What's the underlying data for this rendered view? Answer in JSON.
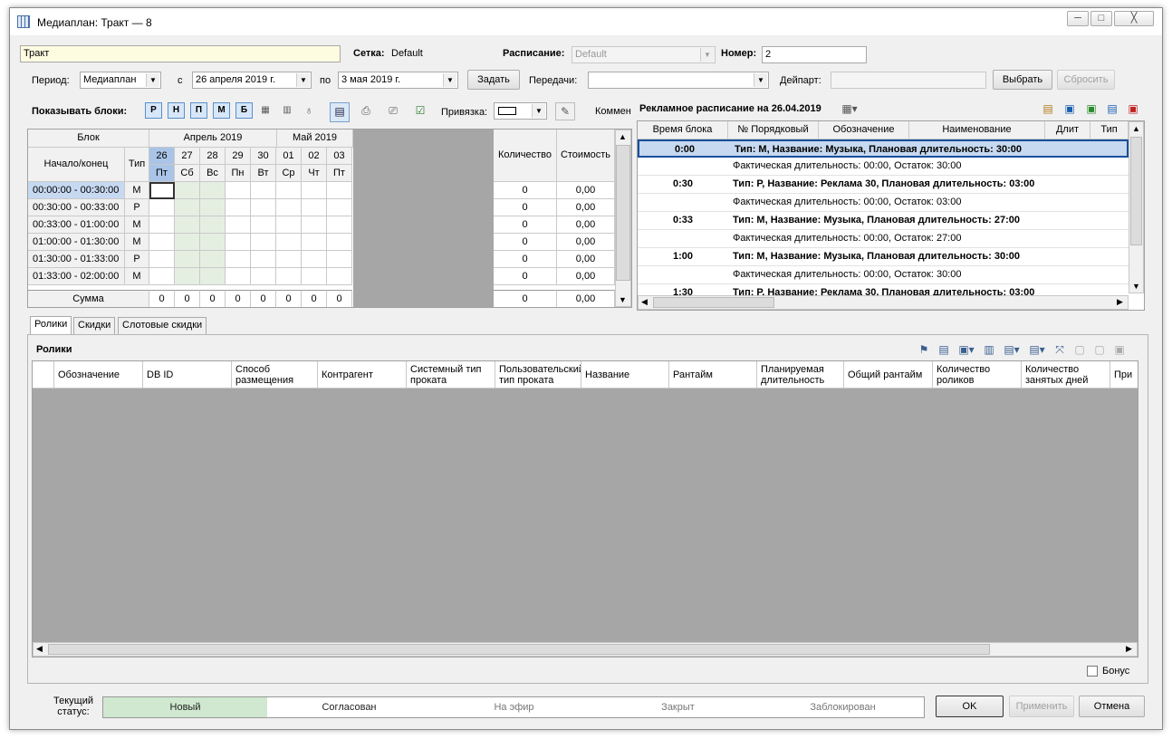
{
  "window": {
    "title": "Медиаплан: Тракт — 8",
    "minimize": "─",
    "maximize": "□",
    "close": "╳"
  },
  "form": {
    "name_value": "Тракт",
    "grid_label": "Сетка:",
    "grid_value": "Default",
    "schedule_label": "Расписание:",
    "schedule_value": "Default",
    "number_label": "Номер:",
    "number_value": "2",
    "period_label": "Период:",
    "period_value": "Медиаплан",
    "from_label": "с",
    "from_value": "26  апреля  2019 г.",
    "to_label": "по",
    "to_value": "3    мая     2019 г.",
    "set_button": "Задать",
    "programs_label": "Передачи:",
    "programs_value": "",
    "daypart_label": "Дейпарт:",
    "daypart_value": "",
    "choose_button": "Выбрать",
    "reset_button": "Сбросить"
  },
  "toolbar": {
    "show_blocks_label": "Показывать блоки:",
    "blocks": [
      "Р",
      "Н",
      "П",
      "М",
      "Б"
    ],
    "binding_label": "Привязка:",
    "comment_label": "Коммен"
  },
  "grid": {
    "block_header": "Блок",
    "start_end_header": "Начало/конец",
    "type_header": "Тип",
    "month1": "Апрель 2019",
    "month2": "Май 2019",
    "days": [
      "26",
      "27",
      "28",
      "29",
      "30",
      "01",
      "02",
      "03"
    ],
    "weekdays": [
      "Пт",
      "Сб",
      "Вс",
      "Пн",
      "Вт",
      "Ср",
      "Чт",
      "Пт"
    ],
    "qty_header": "Количество",
    "cost_header": "Стоимость",
    "rows": [
      {
        "time": "00:00:00 - 00:30:00",
        "type": "М",
        "qty": "0",
        "cost": "0,00"
      },
      {
        "time": "00:30:00 - 00:33:00",
        "type": "Р",
        "qty": "0",
        "cost": "0,00"
      },
      {
        "time": "00:33:00 - 01:00:00",
        "type": "М",
        "qty": "0",
        "cost": "0,00"
      },
      {
        "time": "01:00:00 - 01:30:00",
        "type": "М",
        "qty": "0",
        "cost": "0,00"
      },
      {
        "time": "01:30:00 - 01:33:00",
        "type": "Р",
        "qty": "0",
        "cost": "0,00"
      },
      {
        "time": "01:33:00 - 02:00:00",
        "type": "М",
        "qty": "0",
        "cost": "0,00"
      }
    ],
    "sum_label": "Сумма",
    "sums": [
      "0",
      "0",
      "0",
      "0",
      "0",
      "0",
      "0",
      "0"
    ],
    "sum_qty": "0",
    "sum_cost": "0,00"
  },
  "schedule": {
    "title": "Рекламное расписание на 26.04.2019",
    "columns": [
      "Время блока",
      "№ Порядковый",
      "Обозначение",
      "Наименование",
      "Длит",
      "Тип"
    ],
    "blocks": [
      {
        "time": "0:00",
        "desc": "Тип: М, Название: Музыка, Плановая длительность: 30:00",
        "fact": "Фактическая длительность: 00:00, Остаток: 30:00"
      },
      {
        "time": "0:30",
        "desc": "Тип: Р, Название: Реклама 30, Плановая длительность: 03:00",
        "fact": "Фактическая длительность: 00:00, Остаток: 03:00"
      },
      {
        "time": "0:33",
        "desc": "Тип: М, Название: Музыка, Плановая длительность: 27:00",
        "fact": "Фактическая длительность: 00:00, Остаток: 27:00"
      },
      {
        "time": "1:00",
        "desc": "Тип: М, Название: Музыка, Плановая длительность: 30:00",
        "fact": "Фактическая длительность: 00:00, Остаток: 30:00"
      },
      {
        "time": "1:30",
        "desc": "Тип: Р, Название: Реклама 30, Плановая длительность: 03:00",
        "fact": ""
      }
    ]
  },
  "tabs": [
    "Ролики",
    "Скидки",
    "Слотовые скидки"
  ],
  "clips": {
    "title": "Ролики",
    "columns": [
      "Обозначение",
      "DB ID",
      "Способ размещения",
      "Контрагент",
      "Системный тип проката",
      "Пользовательский тип проката",
      "Название",
      "Рантайм",
      "Планируемая длительность",
      "Общий рантайм",
      "Количество роликов",
      "Количество занятых дней",
      "При"
    ]
  },
  "bonus_label": "Бонус",
  "status": {
    "label": "Текущий статус:",
    "steps": [
      "Новый",
      "Согласован",
      "На эфир",
      "Закрыт",
      "Заблокирован"
    ],
    "active_color": "#cfe8cf"
  },
  "buttons": {
    "ok": "OK",
    "apply": "Применить",
    "cancel": "Отмена"
  }
}
